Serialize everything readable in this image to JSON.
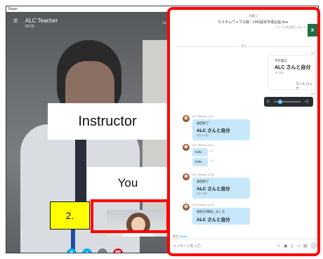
{
  "window": {
    "app_title": "Skype"
  },
  "call": {
    "contact_name": "ALC Teacher",
    "duration": "03:26",
    "labels": {
      "instructor": "Instructor",
      "you": "You",
      "step": "2."
    }
  },
  "chat": {
    "file": {
      "sender": "木曜日",
      "name": "カスタムウェブ公開・LMS設定手順企画.xlsx",
      "status": "ファイルを送信しました"
    },
    "date_divider": "今日",
    "time_file": "10:1",
    "missed_call": {
      "time": "10:1",
      "title": "不在着信",
      "name": "ALC さんと自分",
      "count": "☏ 0分",
      "callback": "コール バック"
    },
    "audio_time": "10:1",
    "messages": [
      {
        "sender": "ALC Teacher, 10:11",
        "lines": [
          "通話終了",
          "ALC さんと自分",
          "2分 51 秒"
        ]
      },
      {
        "sender": "ALC Teacher, 10:14",
        "lines": [
          "hello",
          "hello"
        ]
      },
      {
        "sender": "ALC Teacher, 11:06",
        "lines": [
          "通話終了",
          "ALC さんと自分",
          "2分 3 秒"
        ]
      },
      {
        "sender": "ALC Teacher, 11:13",
        "lines": [
          "通話を開始しました",
          "ALC さんと自分"
        ]
      }
    ],
    "footer": {
      "to_prefix": "経由",
      "to_link": "Skype",
      "placeholder": "メッセージを入力"
    }
  },
  "colors": {
    "highlight_red": "#ff0000",
    "step_yellow": "#ffff00",
    "skype_blue": "#00aff0",
    "end_call_red": "#e81123"
  }
}
